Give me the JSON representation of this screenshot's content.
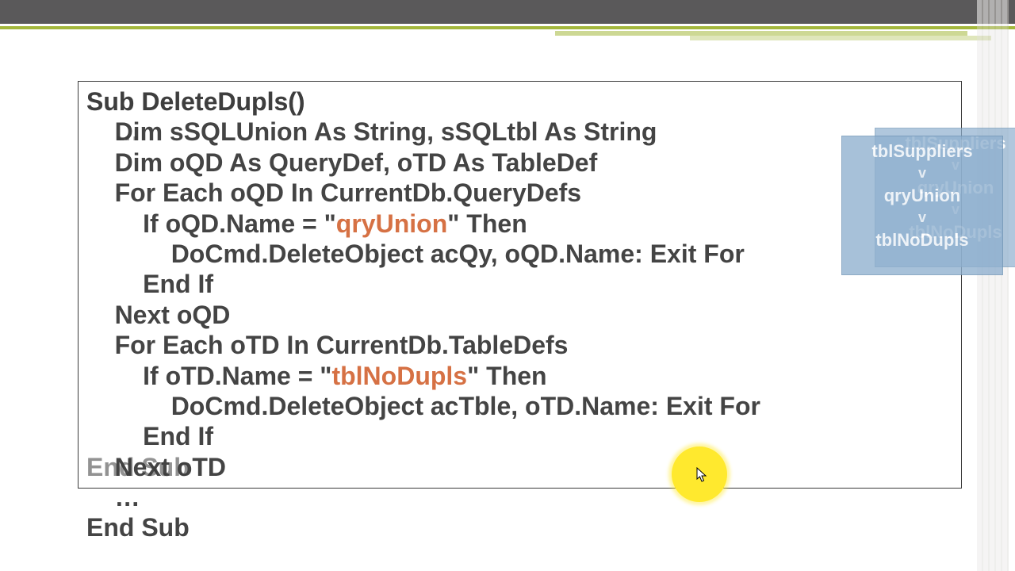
{
  "colors": {
    "accent": "#a4b83d",
    "topbar": "#5a595a",
    "highlight": "#ffe92e",
    "panel": "#8fb0cf",
    "keyword": "#d46a3a"
  },
  "panel": {
    "rows": [
      {
        "label": "tblSuppliers"
      },
      {
        "arrow": "v"
      },
      {
        "label": "qryUnion"
      },
      {
        "arrow": "v"
      },
      {
        "label": "tblNoDupls"
      }
    ]
  },
  "code_under": {
    "l0": "Sub DeleteDupls()",
    "l1": "    …",
    "l2": "",
    "l3": "",
    "l4": "",
    "l5": "",
    "l6": "",
    "l7": "",
    "l8": "",
    "l9": "",
    "l10": "",
    "l11": "",
    "l12": "End Sub"
  },
  "code_over": {
    "l0": "Sub DeleteDupls()",
    "l1a": "    Dim sSQLUnion As String, sSQLtbl As String",
    "l2": "    Dim oQD As QueryDef, oTD As TableDef",
    "l3": "    For Each oQD In CurrentDb.QueryDefs",
    "l4a": "        If oQD.Name = \"",
    "l4b": "qryUnion",
    "l4c": "\" Then",
    "l5": "            DoCmd.DeleteObject acQy, oQD.Name: Exit For",
    "l6": "        End If",
    "l7": "    Next oQD",
    "l8": "    For Each oTD In CurrentDb.TableDefs",
    "l9a": "        If oTD.Name = \"",
    "l9b": "tblNoDupls",
    "l9c": "\" Then",
    "l10": "            DoCmd.DeleteObject acTble, oTD.Name: Exit For",
    "l11": "        End If",
    "l12": "    Next oTD",
    "l13": "    …",
    "l14": "End Sub"
  }
}
